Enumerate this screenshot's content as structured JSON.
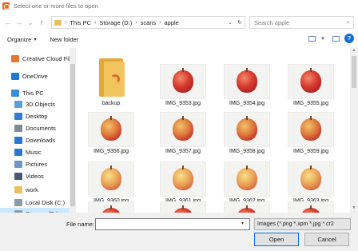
{
  "window": {
    "title": "Select one or more files to open"
  },
  "nav": {
    "back_icon": "←",
    "forward_icon": "→",
    "recent_icon": "⌄",
    "up_icon": "↑",
    "breadcrumb": [
      "This PC",
      "Storage (D:)",
      "scans",
      "apple"
    ],
    "separator": "›",
    "dropdown_icon": "⌄",
    "refresh_icon": "↻",
    "search_placeholder": "Search apple",
    "search_icon": "⌕"
  },
  "toolbar": {
    "organize_label": "Organize",
    "organize_caret": "▾",
    "new_folder_label": "New folder",
    "view_caret": "▾",
    "help_label": "?"
  },
  "sidebar": {
    "items": [
      {
        "label": "Creative Cloud Fil",
        "icon": "creative-cloud-icon",
        "color": "#e8762c"
      },
      {
        "label": "OneDrive",
        "icon": "onedrive-icon",
        "color": "#1e7bd6"
      },
      {
        "label": "This PC",
        "icon": "computer-icon",
        "color": "#3b8ed8"
      },
      {
        "label": "3D Objects",
        "icon": "3d-objects-icon",
        "color": "#5aa0d8"
      },
      {
        "label": "Desktop",
        "icon": "desktop-icon",
        "color": "#2f7fd0"
      },
      {
        "label": "Documents",
        "icon": "documents-icon",
        "color": "#7f8a94"
      },
      {
        "label": "Downloads",
        "icon": "downloads-icon",
        "color": "#2a78cc"
      },
      {
        "label": "Music",
        "icon": "music-icon",
        "color": "#2a78cc"
      },
      {
        "label": "Pictures",
        "icon": "pictures-icon",
        "color": "#6c98c4"
      },
      {
        "label": "Videos",
        "icon": "videos-icon",
        "color": "#4a5b70"
      },
      {
        "label": "work",
        "icon": "folder-icon",
        "color": "#e8c062"
      },
      {
        "label": "Local Disk (C:)",
        "icon": "drive-icon",
        "color": "#8a9aa8"
      },
      {
        "label": "Storage (D:)",
        "icon": "drive-icon",
        "color": "#8a9aa8"
      }
    ]
  },
  "files": [
    {
      "name": "backup",
      "kind": "folder"
    },
    {
      "name": "IMG_9353.jpg",
      "kind": "red"
    },
    {
      "name": "IMG_9354.jpg",
      "kind": "red"
    },
    {
      "name": "IMG_9355.jpg",
      "kind": "red"
    },
    {
      "name": "IMG_9356.jpg",
      "kind": "mix"
    },
    {
      "name": "IMG_9357.jpg",
      "kind": "mix"
    },
    {
      "name": "IMG_9358.jpg",
      "kind": "mix"
    },
    {
      "name": "IMG_9359.jpg",
      "kind": "mix"
    },
    {
      "name": "IMG_9360.jpg",
      "kind": "yellow"
    },
    {
      "name": "IMG_9361.jpg",
      "kind": "yellow"
    },
    {
      "name": "IMG_9362.jpg",
      "kind": "yellow"
    },
    {
      "name": "IMG_9363.jpg",
      "kind": "yellow"
    },
    {
      "name": "",
      "kind": "red"
    },
    {
      "name": "",
      "kind": "red"
    },
    {
      "name": "",
      "kind": "red"
    },
    {
      "name": "",
      "kind": "red"
    }
  ],
  "bottom": {
    "filename_label": "File name:",
    "filename_value": "",
    "filename_caret": "▾",
    "filetype_value": "Images (*.png *.xpm *.jpg *.cr2",
    "open_label": "Open",
    "cancel_label": "Cancel"
  },
  "colors": {
    "accent": "#0078d7",
    "selection": "#cce8ff",
    "help": "#1a6fd2"
  }
}
